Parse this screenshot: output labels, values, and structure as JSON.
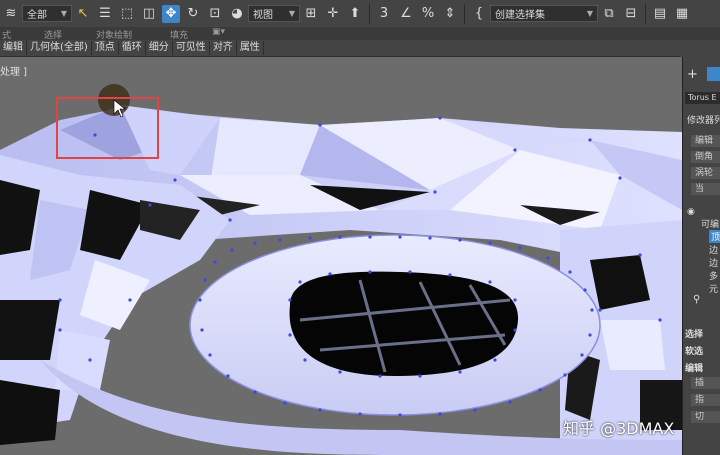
{
  "toolbar": {
    "filter_value": "全部",
    "view_value": "视图",
    "selection_set_placeholder": "创建选择集",
    "percent_snap": "%",
    "colors": {
      "accent": "#3d86c9",
      "selection_rect": "#e04545"
    }
  },
  "toolbar_labels": {
    "a": "式",
    "b": "选择",
    "c": "对象绘制",
    "d": "填充"
  },
  "menubar": {
    "items": [
      "编辑",
      "几何体(全部)",
      "顶点",
      "循环",
      "细分",
      "可见性",
      "对齐",
      "属性"
    ]
  },
  "viewport": {
    "label": "处理 ]"
  },
  "command_panel": {
    "object_name": "Torus E",
    "modifier_list": "修改器列",
    "buttons": [
      "编辑",
      "倒角",
      "涡轮",
      "当"
    ],
    "stack_items": [
      "可编",
      "顶",
      "边",
      "边",
      "多",
      "元"
    ],
    "sections": [
      "选择",
      "软选",
      "编辑",
      "插",
      "指",
      "切"
    ]
  },
  "watermark": {
    "text": "知乎 @3DMAX"
  }
}
